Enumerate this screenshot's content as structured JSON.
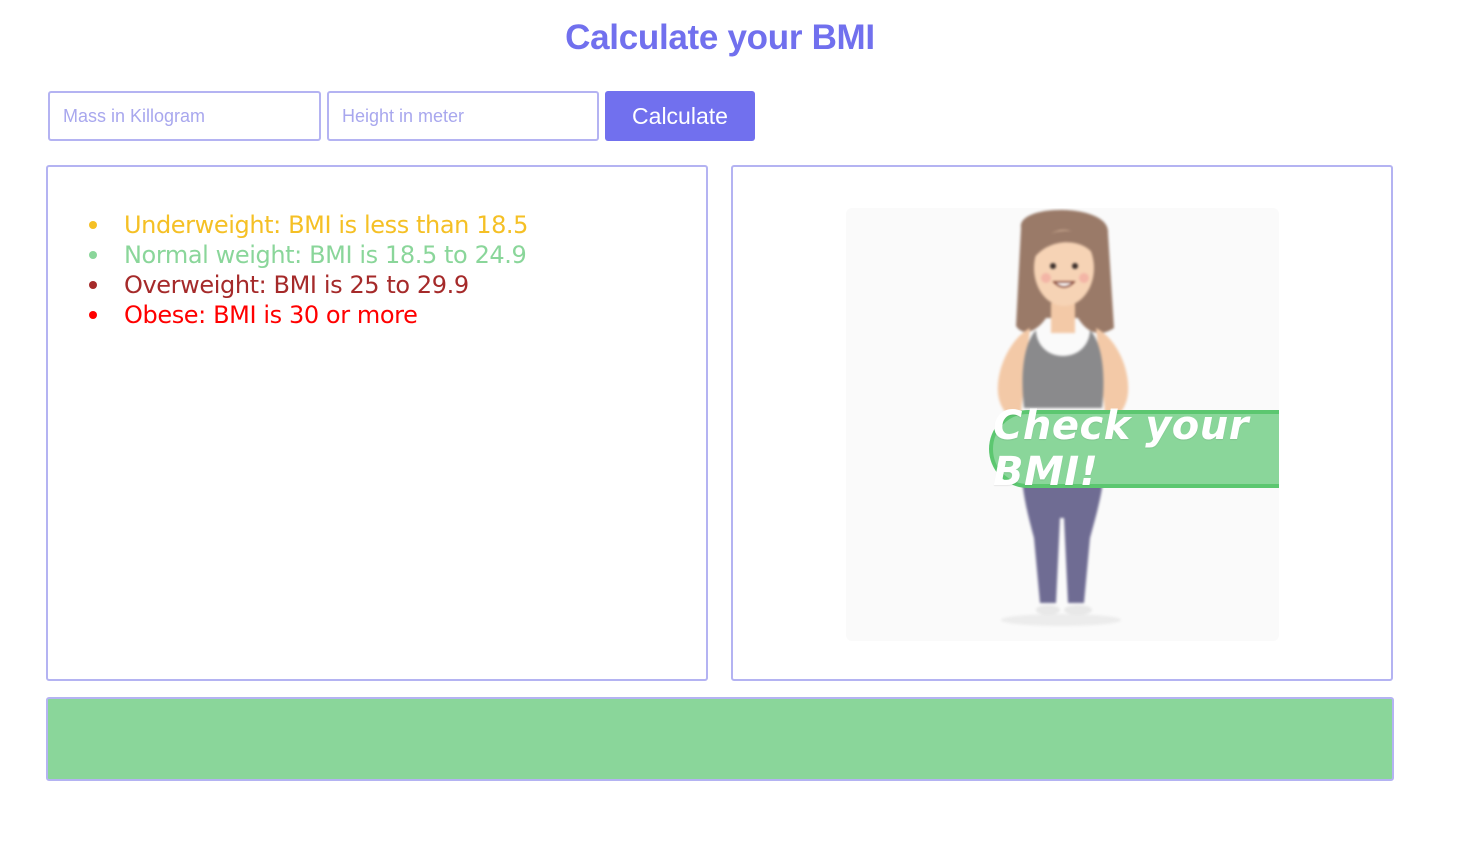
{
  "page": {
    "title": "Calculate your BMI"
  },
  "form": {
    "mass_placeholder": "Mass in Killogram",
    "height_placeholder": "Height in meter",
    "calculate_label": "Calculate"
  },
  "categories": [
    {
      "label": "Underweight: BMI is less than 18.5",
      "color": "#f5c025"
    },
    {
      "label": "Normal weight: BMI is 18.5 to 24.9",
      "color": "#8ad69a"
    },
    {
      "label": "Overweight: BMI is 25 to 29.9",
      "color": "#a52a2a"
    },
    {
      "label": "Obese: BMI is 30 or more",
      "color": "#ff0000"
    }
  ],
  "illustration": {
    "cta_label": "Check your BMI!"
  },
  "result": {
    "text": "",
    "color": "#8ad69a"
  },
  "colors": {
    "accent": "#7170ee",
    "border": "#b4b3f2"
  }
}
